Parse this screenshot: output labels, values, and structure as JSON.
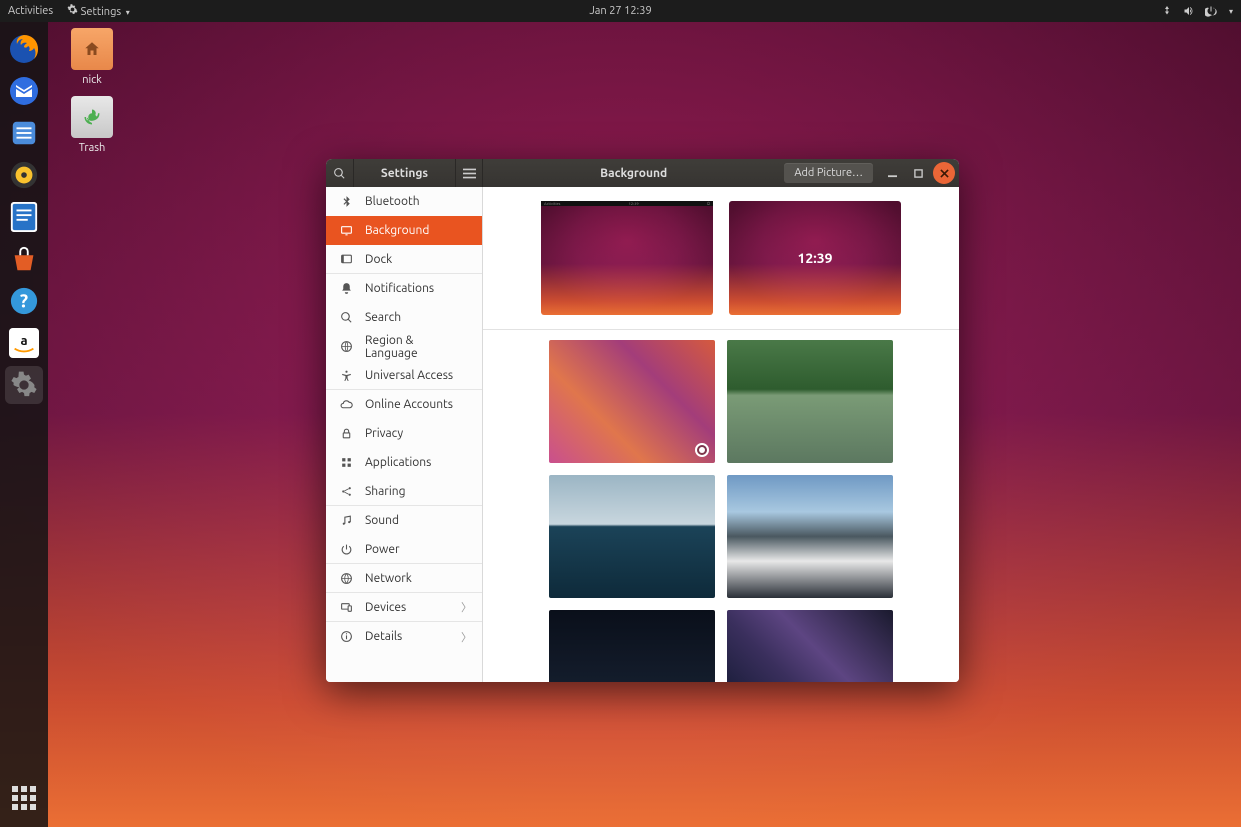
{
  "topbar": {
    "activities": "Activities",
    "app_indicator": "Settings",
    "datetime": "Jan 27  12:39"
  },
  "desktop_icons": {
    "home": "nick",
    "trash": "Trash"
  },
  "window": {
    "sidebar_title": "Settings",
    "content_title": "Background",
    "add_picture": "Add Picture…",
    "lock_time": "12:39"
  },
  "sidebar": {
    "items": [
      {
        "label": "Bluetooth"
      },
      {
        "label": "Background"
      },
      {
        "label": "Dock"
      },
      {
        "label": "Notifications"
      },
      {
        "label": "Search"
      },
      {
        "label": "Region & Language"
      },
      {
        "label": "Universal Access"
      },
      {
        "label": "Online Accounts"
      },
      {
        "label": "Privacy"
      },
      {
        "label": "Applications"
      },
      {
        "label": "Sharing"
      },
      {
        "label": "Sound"
      },
      {
        "label": "Power"
      },
      {
        "label": "Network"
      },
      {
        "label": "Devices"
      },
      {
        "label": "Details"
      }
    ]
  }
}
